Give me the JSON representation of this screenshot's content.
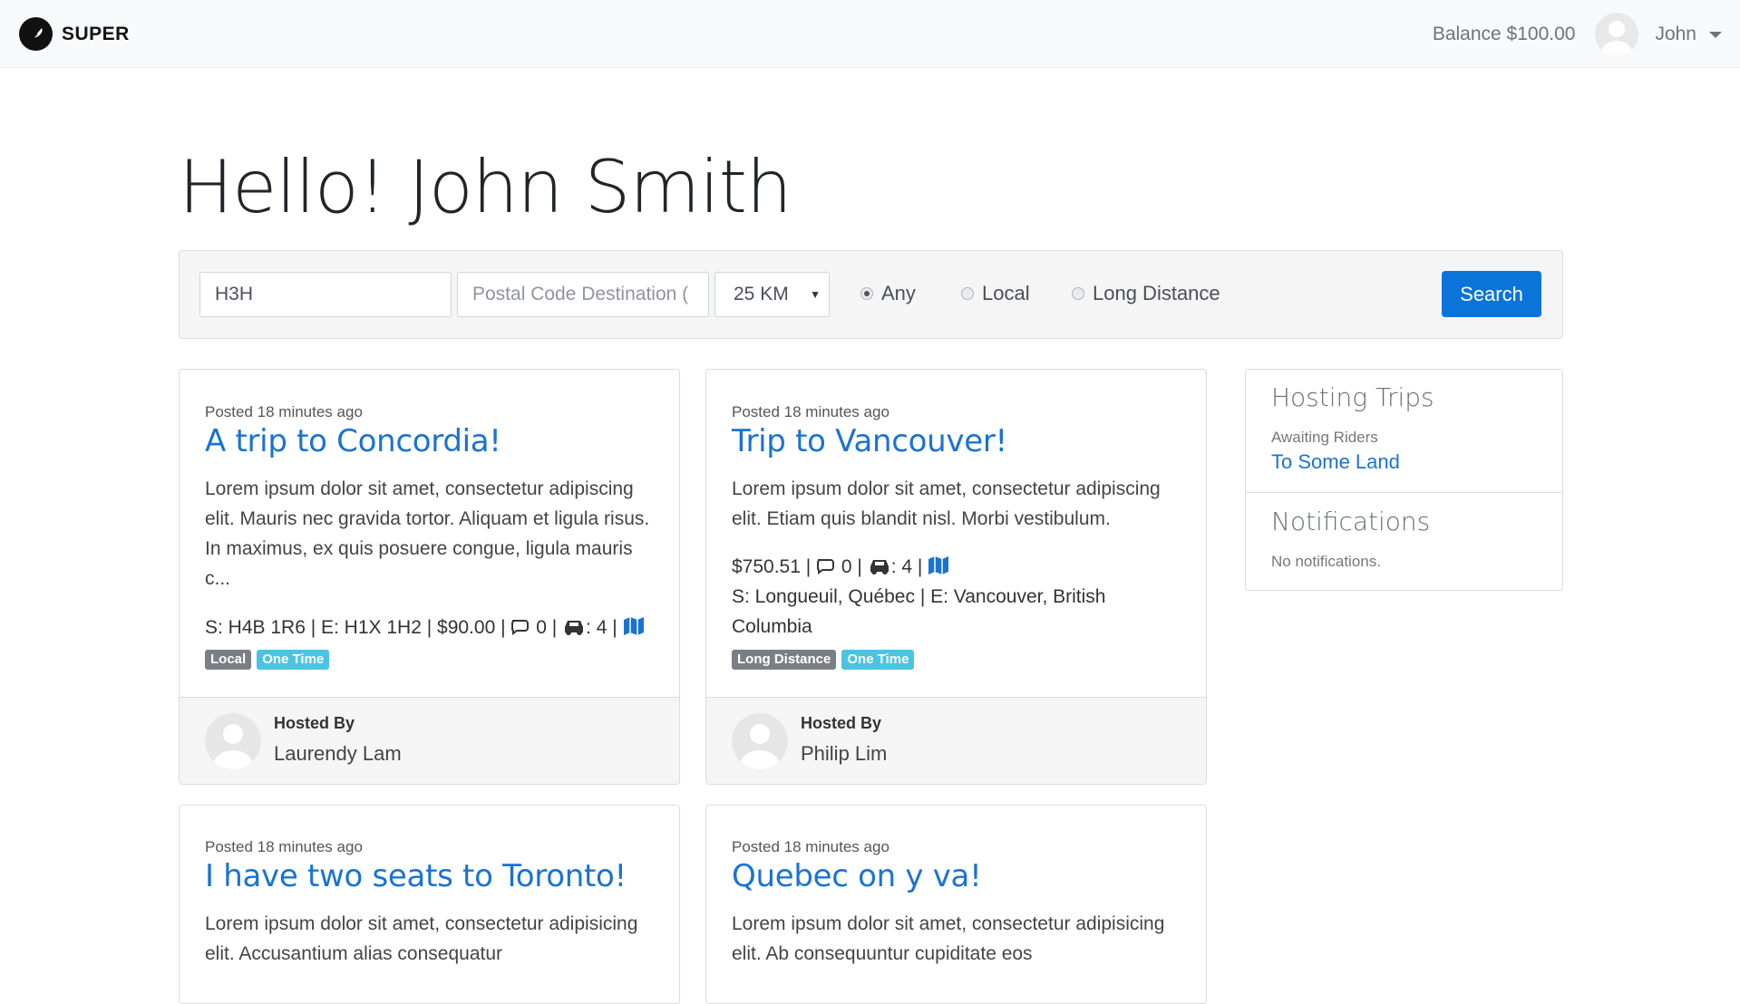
{
  "navbar": {
    "brand": "SUPER",
    "balance": "Balance $100.00",
    "user": "John"
  },
  "greeting": "Hello! John Smith",
  "search": {
    "origin_value": "H3H",
    "destination_placeholder": "Postal Code Destination (",
    "distance": "25 KM",
    "radio_any": "Any",
    "radio_local": "Local",
    "radio_long": "Long Distance",
    "selected": "Any",
    "button": "Search"
  },
  "trips": [
    {
      "posted": "Posted 18 minutes ago",
      "title": "A trip to Concordia!",
      "desc": "Lorem ipsum dolor sit amet, consectetur adipiscing elit. Mauris nec gravida tortor. Aliquam et ligula risus. In maximus, ex quis posuere congue, ligula mauris c...",
      "route": "S: H4B 1R6 | E: H1X 1H2 | $90.00 |",
      "comments": "0",
      "seats": ": 4",
      "badges": [
        "Local",
        "One Time"
      ],
      "hosted_label": "Hosted By",
      "host": "Laurendy Lam"
    },
    {
      "posted": "Posted 18 minutes ago",
      "title": "Trip to Vancouver!",
      "desc": "Lorem ipsum dolor sit amet, consectetur adipiscing elit. Etiam quis blandit nisl. Morbi vestibulum.",
      "price": "$750.51 |",
      "comments": "0",
      "seats": ": 4",
      "route": "S: Longueuil, Québec | E: Vancouver, British Columbia",
      "badges": [
        "Long Distance",
        "One Time"
      ],
      "hosted_label": "Hosted By",
      "host": "Philip Lim"
    },
    {
      "posted": "Posted 18 minutes ago",
      "title": "I have two seats to Toronto!",
      "desc": "Lorem ipsum dolor sit amet, consectetur adipisicing elit. Accusantium alias consequatur"
    },
    {
      "posted": "Posted 18 minutes ago",
      "title": "Quebec on y va!",
      "desc": "Lorem ipsum dolor sit amet, consectetur adipisicing elit. Ab consequuntur cupiditate eos"
    }
  ],
  "sidebar": {
    "hosting_title": "Hosting Trips",
    "awaiting": "Awaiting Riders",
    "trip_link": "To Some Land",
    "notifications_title": "Notifications",
    "notifications_empty": "No notifications."
  },
  "colors": {
    "link": "#1a73d1",
    "primary_button": "#0b74d9",
    "badge_gray": "#7a7f85",
    "badge_teal": "#4cc3e3"
  }
}
